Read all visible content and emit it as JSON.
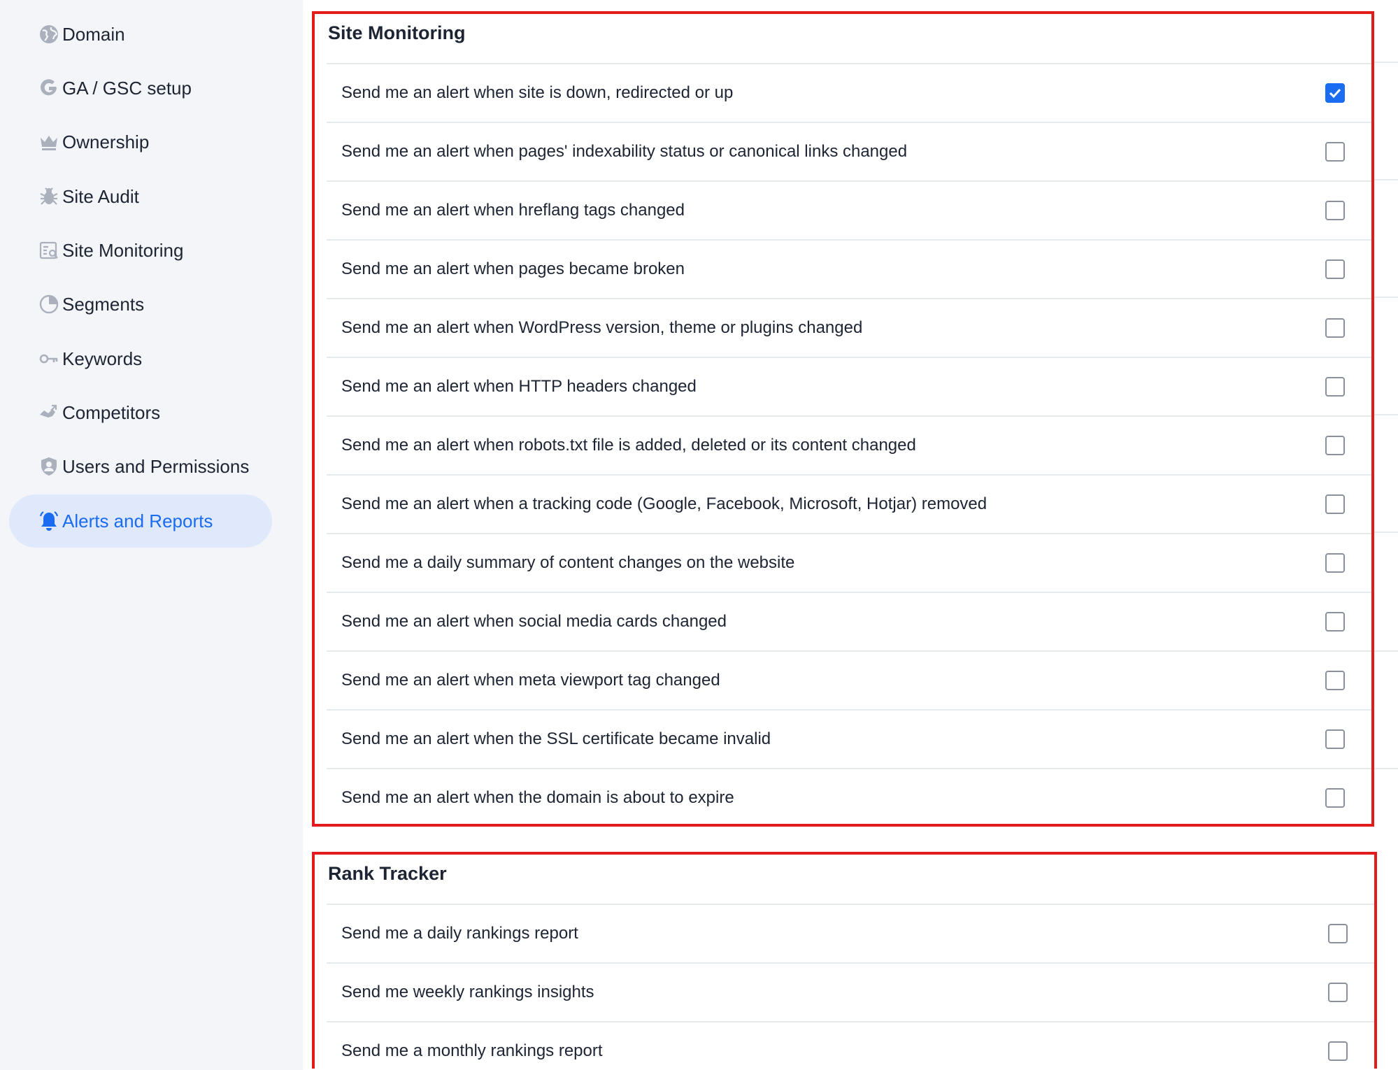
{
  "sidebar": {
    "items": [
      {
        "label": "Domain",
        "icon": "globe-icon",
        "active": false
      },
      {
        "label": "GA / GSC setup",
        "icon": "google-icon",
        "active": false
      },
      {
        "label": "Ownership",
        "icon": "crown-icon",
        "active": false
      },
      {
        "label": "Site Audit",
        "icon": "bug-icon",
        "active": false
      },
      {
        "label": "Site Monitoring",
        "icon": "monitor-search-icon",
        "active": false
      },
      {
        "label": "Segments",
        "icon": "pie-chart-icon",
        "active": false
      },
      {
        "label": "Keywords",
        "icon": "key-icon",
        "active": false
      },
      {
        "label": "Competitors",
        "icon": "competitors-icon",
        "active": false
      },
      {
        "label": "Users and Permissions",
        "icon": "shield-user-icon",
        "active": false
      },
      {
        "label": "Alerts and Reports",
        "icon": "bell-icon",
        "active": true
      }
    ]
  },
  "site_monitoring": {
    "title": "Site Monitoring",
    "rows": [
      {
        "label": "Send me an alert when site is down, redirected or up",
        "checked": true
      },
      {
        "label": "Send me an alert when pages' indexability status or canonical links changed",
        "checked": false
      },
      {
        "label": "Send me an alert when hreflang tags changed",
        "checked": false
      },
      {
        "label": "Send me an alert when pages became broken",
        "checked": false
      },
      {
        "label": "Send me an alert when WordPress version, theme or plugins changed",
        "checked": false
      },
      {
        "label": "Send me an alert when HTTP headers changed",
        "checked": false
      },
      {
        "label": "Send me an alert when robots.txt file is added, deleted or its content changed",
        "checked": false
      },
      {
        "label": "Send me an alert when a tracking code (Google, Facebook, Microsoft, Hotjar) removed",
        "checked": false
      },
      {
        "label": "Send me a daily summary of content changes on the website",
        "checked": false
      },
      {
        "label": "Send me an alert when social media cards changed",
        "checked": false
      },
      {
        "label": "Send me an alert when meta viewport tag changed",
        "checked": false
      },
      {
        "label": "Send me an alert when the SSL certificate became invalid",
        "checked": false
      },
      {
        "label": "Send me an alert when the domain is about to expire",
        "checked": false
      }
    ]
  },
  "rank_tracker": {
    "title": "Rank Tracker",
    "rows": [
      {
        "label": "Send me a daily rankings report",
        "checked": false
      },
      {
        "label": "Send me weekly rankings insights",
        "checked": false
      },
      {
        "label": "Send me a monthly rankings report",
        "checked": false
      }
    ]
  },
  "colors": {
    "accent": "#1a6cf0",
    "highlight_border": "#e21b1b",
    "active_nav_bg": "#e0e9fb",
    "sidebar_bg": "#f3f5f8"
  }
}
